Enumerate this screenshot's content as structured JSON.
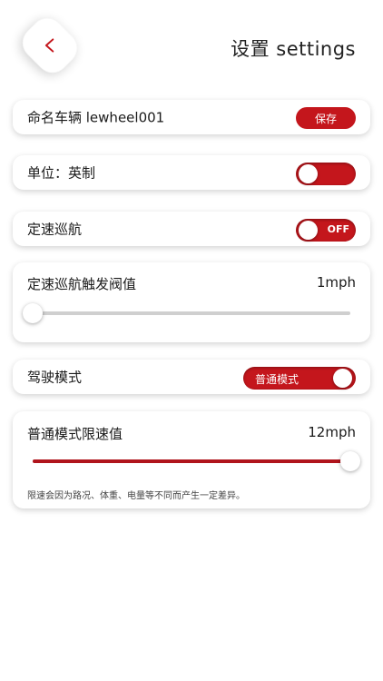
{
  "header": {
    "title": "设置 settings",
    "back_icon": "chevron-left-icon"
  },
  "vehicle_name": {
    "label": "命名车辆 lewheel001",
    "save_label": "保存"
  },
  "unit": {
    "label": "单位：英制",
    "toggle_on": true
  },
  "cruise": {
    "label": "定速巡航",
    "toggle_text": "OFF"
  },
  "cruise_threshold": {
    "label": "定速巡航触发阀值",
    "value": "1mph",
    "slider_fraction": 0
  },
  "drive_mode": {
    "label": "驾驶模式",
    "value": "普通模式"
  },
  "speed_limit": {
    "label": "普通模式限速值",
    "value": "12mph",
    "slider_fraction": 1,
    "note": "限速会因为路况、体重、电量等不同而产生一定差异。"
  },
  "colors": {
    "accent": "#c4161c",
    "track": "#cfcfcf",
    "background": "#ffffff"
  }
}
